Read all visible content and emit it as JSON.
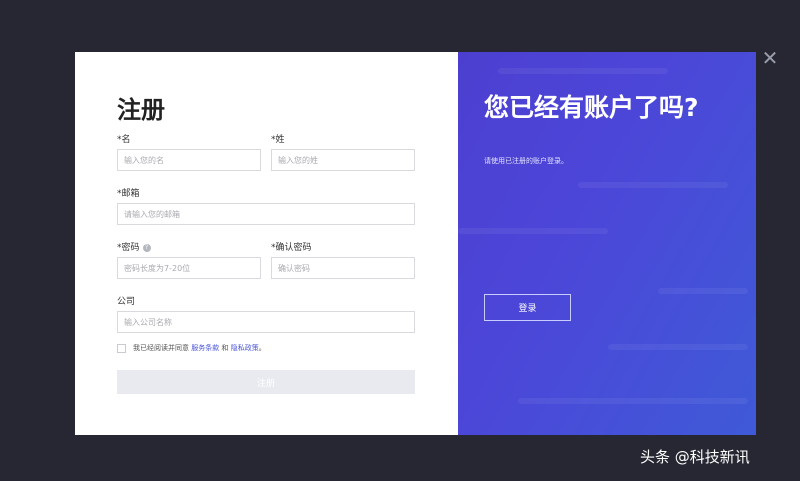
{
  "close_icon": "✕",
  "register": {
    "title": "注册",
    "first_name": {
      "label": "*名",
      "placeholder": "输入您的名"
    },
    "last_name": {
      "label": "*姓",
      "placeholder": "输入您的姓"
    },
    "email": {
      "label": "*邮箱",
      "placeholder": "请输入您的邮箱"
    },
    "password": {
      "label": "*密码",
      "placeholder": "密码长度为7-20位"
    },
    "confirm_password": {
      "label": "*确认密码",
      "placeholder": "确认密码"
    },
    "company": {
      "label": "公司",
      "placeholder": "输入公司名称"
    },
    "agree": {
      "prefix": "我已经阅读并同意",
      "terms": "服务条款",
      "and": "和",
      "privacy": "隐私政策",
      "suffix": "。"
    },
    "submit_label": "注册"
  },
  "promo": {
    "title": "您已经有账户了吗?",
    "subtitle": "请使用已注册的账户登录。",
    "login_label": "登录"
  },
  "watermark": "头条 @科技新讯",
  "colors": {
    "accent": "#4c46d8",
    "backdrop": "#262733"
  }
}
